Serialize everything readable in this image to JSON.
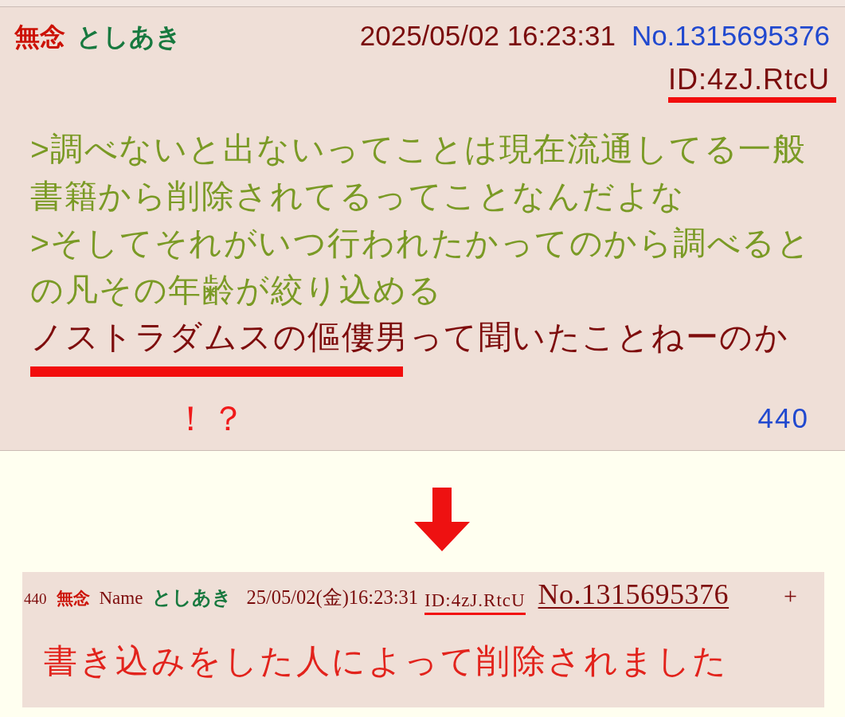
{
  "post": {
    "subject": "無念",
    "name": "としあき",
    "date": "2025/05/02 16:23:31",
    "number": "No.1315695376",
    "id": {
      "text": "ID:4zJ.RtcU",
      "marked": true
    },
    "lines": [
      {
        "kind": "quote",
        "text": ">調べないと出ないってことは現在流通してる一般"
      },
      {
        "kind": "quote",
        "text": "書籍から削除されてるってことなんだよな"
      },
      {
        "kind": "quote",
        "text": ">そしてそれがいつ行われたかってのから調べると"
      },
      {
        "kind": "quote",
        "text": "の凡その年齢が絞り込める"
      },
      {
        "kind": "text",
        "underlined_text": "ノストラダムスの傴僂男",
        "text": "って聞いたことねーのか"
      }
    ],
    "annotation": "！？",
    "reply_count": "440"
  },
  "deleted_post": {
    "index": "440",
    "subject": "無念",
    "name_label": "Name",
    "name": "としあき",
    "date": "25/05/02(金)16:23:31",
    "id": {
      "text": "ID:4zJ.RtcU",
      "marked": true
    },
    "number": "No.1315695376",
    "menu": "+",
    "message": "書き込みをした人によって削除されました"
  }
}
